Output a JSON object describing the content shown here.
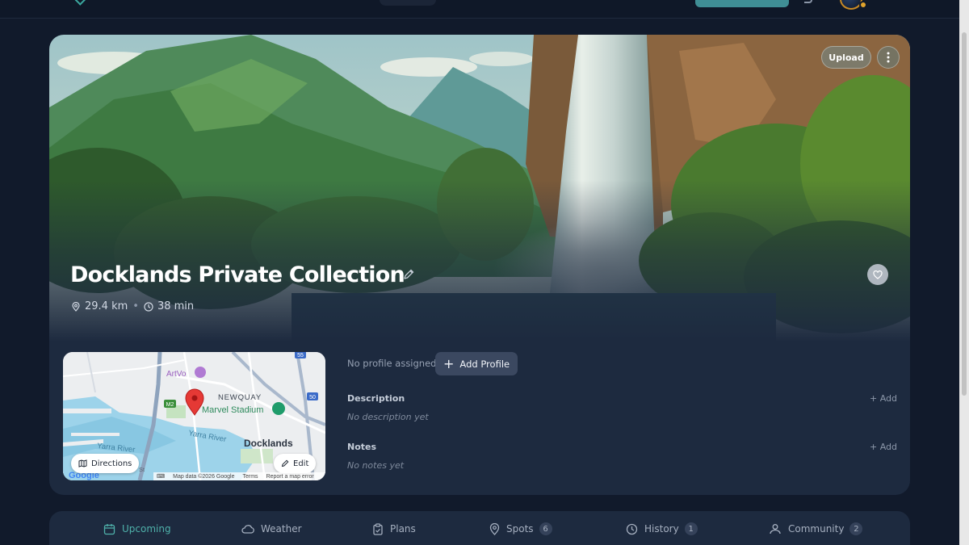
{
  "hero": {
    "title": "Docklands Private Collection",
    "distance": "29.4 km",
    "separator": "•",
    "duration": "38 min",
    "upload_label": "Upload"
  },
  "map": {
    "labels": {
      "artvo": "ArtVo",
      "newquay": "NEWQUAY",
      "stadium": "Marvel Stadium",
      "yarra_river_1": "Yarra River",
      "yarra_river_2": "Yarra River",
      "docklands": "Docklands",
      "road_m2": "M2",
      "road_55": "55",
      "road_50": "50",
      "st": "St",
      "google": "Google"
    },
    "directions_label": "Directions",
    "edit_label": "Edit",
    "attribution": {
      "map_data": "Map data ©2026 Google",
      "terms": "Terms",
      "report": "Report a map error"
    }
  },
  "profile": {
    "status": "No profile assigned",
    "add_label": "Add Profile",
    "add_symbol": "+"
  },
  "description": {
    "label": "Description",
    "empty": "No description yet",
    "add": "+ Add"
  },
  "notes": {
    "label": "Notes",
    "empty": "No notes yet",
    "add": "+ Add"
  },
  "tabs": [
    {
      "label": "Upcoming",
      "icon": "calendar-icon",
      "active": true
    },
    {
      "label": "Weather",
      "icon": "cloud-icon"
    },
    {
      "label": "Plans",
      "icon": "clipboard-icon"
    },
    {
      "label": "Spots",
      "icon": "map-pin-icon",
      "badge": "6"
    },
    {
      "label": "History",
      "icon": "clock-icon",
      "badge": "1"
    },
    {
      "label": "Community",
      "icon": "users-icon",
      "badge": "2"
    }
  ],
  "colors": {
    "page_bg": "#111a2b",
    "card_bg": "#1d2a3f",
    "accent": "#4fb1aa",
    "map_pin": "#e53935"
  }
}
